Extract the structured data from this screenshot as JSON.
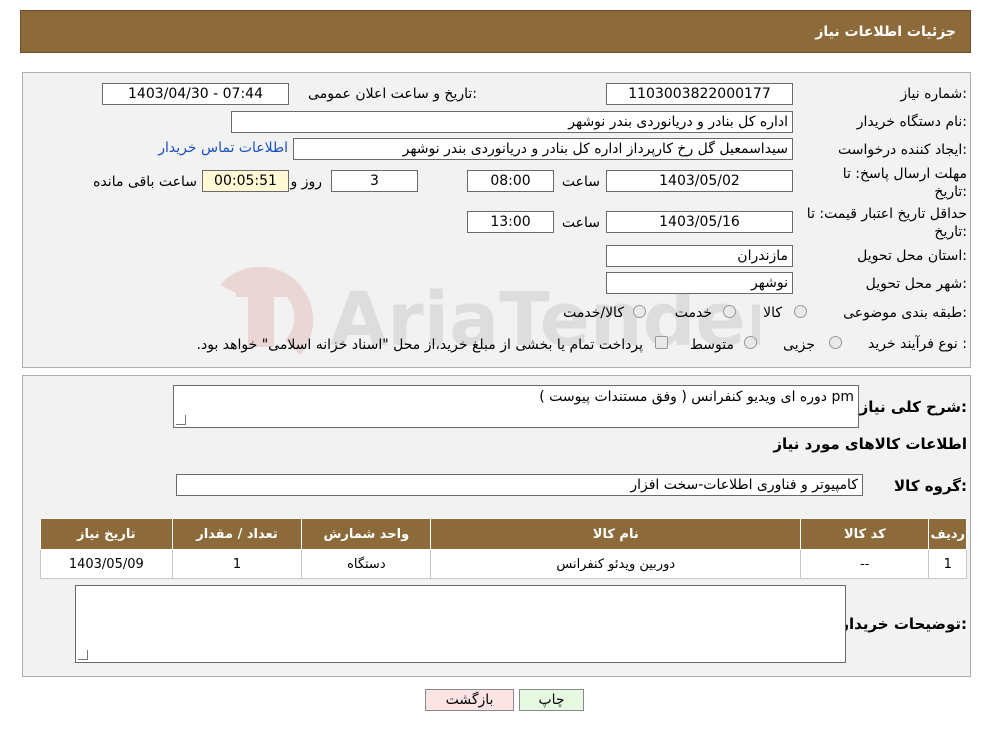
{
  "header": {
    "title": "جزئیات اطلاعات نیاز"
  },
  "form": {
    "need_number_label": "شماره نیاز:",
    "need_number": "1103003822000177",
    "announce_label": "تاریخ و ساعت اعلان عمومی:",
    "announce_value": "1403/04/30 - 07:44",
    "buyer_org_label": "نام دستگاه خریدار:",
    "buyer_org": "اداره کل بنادر و دریانوردی بندر نوشهر",
    "creator_label": "ایجاد کننده درخواست:",
    "creator": "سیداسمعیل گل رخ کارپرداز اداره کل بنادر و دریانوردی بندر نوشهر",
    "contact_link": "اطلاعات تماس خریدار",
    "deadline_label_line1": "مهلت ارسال پاسخ: تا",
    "deadline_label_line2": "تاریخ:",
    "deadline_date": "1403/05/02",
    "time_label": "ساعت",
    "deadline_time": "08:00",
    "days_value": "3",
    "days_label": "روز و",
    "remaining_time": "00:05:51",
    "remaining_label": "ساعت باقی مانده",
    "validity_label_line1": "حداقل تاریخ اعتبار قیمت: تا",
    "validity_label_line2": "تاریخ:",
    "validity_date": "1403/05/16",
    "validity_time": "13:00",
    "province_label": "استان محل تحویل:",
    "province": "مازندران",
    "city_label": "شهر محل تحویل:",
    "city": "نوشهر",
    "category_label": "طبقه بندی موضوعی:",
    "category_options": [
      "کالا",
      "خدمت",
      "کالا/خدمت"
    ],
    "process_label": "نوع فرآیند خرید :",
    "process_options": [
      "جزیی",
      "متوسط"
    ],
    "process_note": "پرداخت تمام یا بخشی از مبلغ خرید،از محل \"اسناد خزانه اسلامی\" خواهد بود."
  },
  "details": {
    "summary_label": "شرح کلی نیاز:",
    "summary": "pm دوره ای ویدیو کنفرانس ( وفق مستندات پیوست )",
    "goods_info_title": "اطلاعات کالاهای مورد نیاز",
    "goods_group_label": "گروه کالا:",
    "goods_group": "کامپیوتر و فناوری اطلاعات-سخت افزار",
    "table": {
      "headers": [
        "ردیف",
        "کد کالا",
        "نام کالا",
        "واحد شمارش",
        "تعداد / مقدار",
        "تاریخ نیاز"
      ],
      "rows": [
        [
          "1",
          "--",
          "دوربین ویدئو کنفرانس",
          "دستگاه",
          "1",
          "1403/05/09"
        ]
      ]
    },
    "buyer_notes_label": "توضیحات خریدار:"
  },
  "buttons": {
    "print": "چاپ",
    "back": "بازگشت"
  },
  "watermark": {
    "text": "AriaTender.neT"
  },
  "colors": {
    "header_bg": "#8c6a3a",
    "timer_bg": "#fff9d6",
    "back_btn_bg": "#fce4e4",
    "print_btn_bg": "#e6f8e0",
    "link": "#1a4fc0"
  }
}
